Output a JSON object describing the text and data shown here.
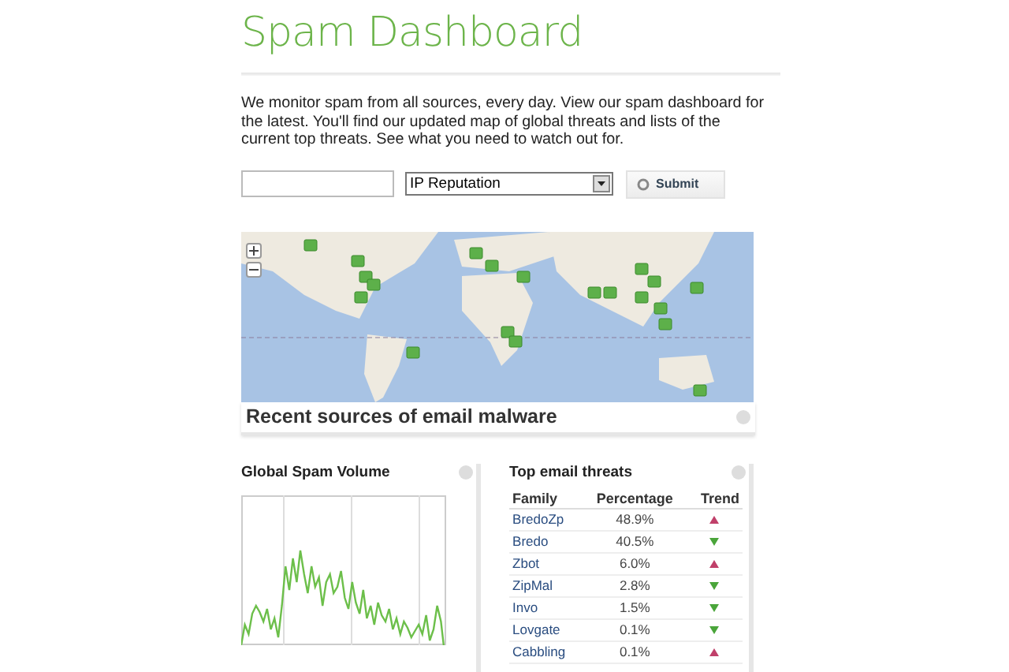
{
  "title": "Spam Dashboard",
  "intro": "We monitor spam from all sources, every day. View our spam dashboard for the latest. You'll find our updated map of global threats and lists of the current top threats. See what you need to watch out for.",
  "lookup": {
    "select": "IP Reputation",
    "button": "Submit"
  },
  "map": {
    "kind": "picture",
    "caption": "Recent sources of email malware"
  },
  "volume": {
    "title": "Global Spam Volume"
  },
  "threats": {
    "title": "Top email threats",
    "columns": [
      "Family",
      "Percentage",
      "Trend"
    ],
    "rows": [
      {
        "family": "BredoZp",
        "percentage": "48.9%",
        "rising": true
      },
      {
        "family": "Bredo",
        "percentage": "40.5%",
        "rising": false
      },
      {
        "family": "Zbot",
        "percentage": "6.0%",
        "rising": true
      },
      {
        "family": "ZipMal",
        "percentage": "2.8%",
        "rising": false
      },
      {
        "family": "Invo",
        "percentage": "1.5%",
        "rising": false
      },
      {
        "family": "Lovgate",
        "percentage": "0.1%",
        "rising": false
      },
      {
        "family": "Cabbling",
        "percentage": "0.1%",
        "rising": true
      }
    ]
  }
}
